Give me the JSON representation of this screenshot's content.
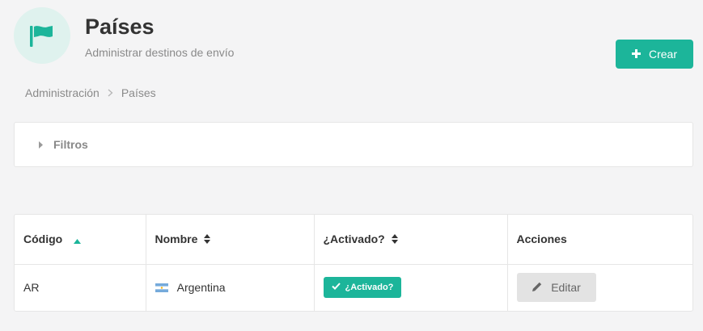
{
  "header": {
    "icon": "flag-icon",
    "title": "Países",
    "subtitle": "Administrar destinos de envío",
    "create_label": "Crear",
    "accent_color": "#1cb59a"
  },
  "breadcrumb": {
    "items": [
      "Administración",
      "Países"
    ]
  },
  "filters": {
    "label": "Filtros"
  },
  "table": {
    "columns": [
      "Código",
      "Nombre",
      "¿Activado?",
      "Acciones"
    ],
    "sort": {
      "column": "Código",
      "direction": "asc"
    },
    "rows": [
      {
        "code": "AR",
        "name": "Argentina",
        "flag": "argentina-flag-icon",
        "active_label": "¿Activado?",
        "action_label": "Editar"
      }
    ]
  }
}
